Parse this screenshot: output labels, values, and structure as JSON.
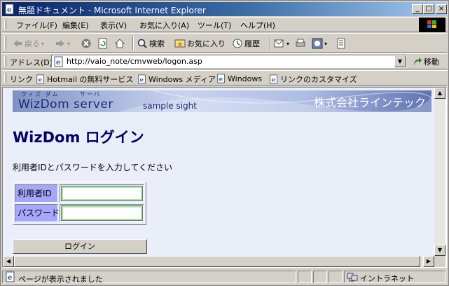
{
  "window": {
    "title": "無題ドキュメント - Microsoft Internet Explorer",
    "controls": {
      "minimize": "_",
      "maximize": "□",
      "close": "×"
    }
  },
  "menu": [
    "ファイル(F)",
    "編集(E)",
    "表示(V)",
    "お気に入り(A)",
    "ツール(T)",
    "ヘルプ(H)"
  ],
  "toolbar": {
    "back": "戻る",
    "search": "検索",
    "favorites": "お気に入り",
    "history": "履歴"
  },
  "address": {
    "label": "アドレス(D)",
    "url": "http://vaio_note/cmvweb/logon.asp",
    "go": "移動"
  },
  "links": {
    "label": "リンク",
    "items": [
      "Hotmail の無料サービス",
      "Windows メディア",
      "Windows",
      "リンクのカスタマイズ"
    ]
  },
  "page": {
    "banner": {
      "ruby_wizdom": "ウィズ ダム",
      "ruby_server": "サーバ",
      "brand": "WizDom  server",
      "sample": "sample sight",
      "company": "株式会社ラインテック"
    },
    "heading": "WizDom ログイン",
    "instruction": "利用者IDとパスワードを入力してください",
    "form": {
      "user_id_label": "利用者ID",
      "password_label": "パスワード",
      "user_id_value": "",
      "password_value": ""
    },
    "login_button": "ログイン"
  },
  "status": {
    "text": "ページが表示されました",
    "zone": "イントラネット"
  },
  "colors": {
    "titlebar_start": "#0a246a",
    "heading": "#000066",
    "label_bg": "#a6a6ff",
    "page_bg": "#eaeef8"
  },
  "icons": [
    "ie-page-icon",
    "back-arrow-icon",
    "forward-arrow-icon",
    "stop-icon",
    "refresh-icon",
    "home-icon",
    "search-icon",
    "favorites-icon",
    "history-icon",
    "mail-icon",
    "print-icon",
    "edit-icon",
    "discuss-icon",
    "go-arrow-icon",
    "intranet-icon",
    "windows-logo-icon"
  ]
}
